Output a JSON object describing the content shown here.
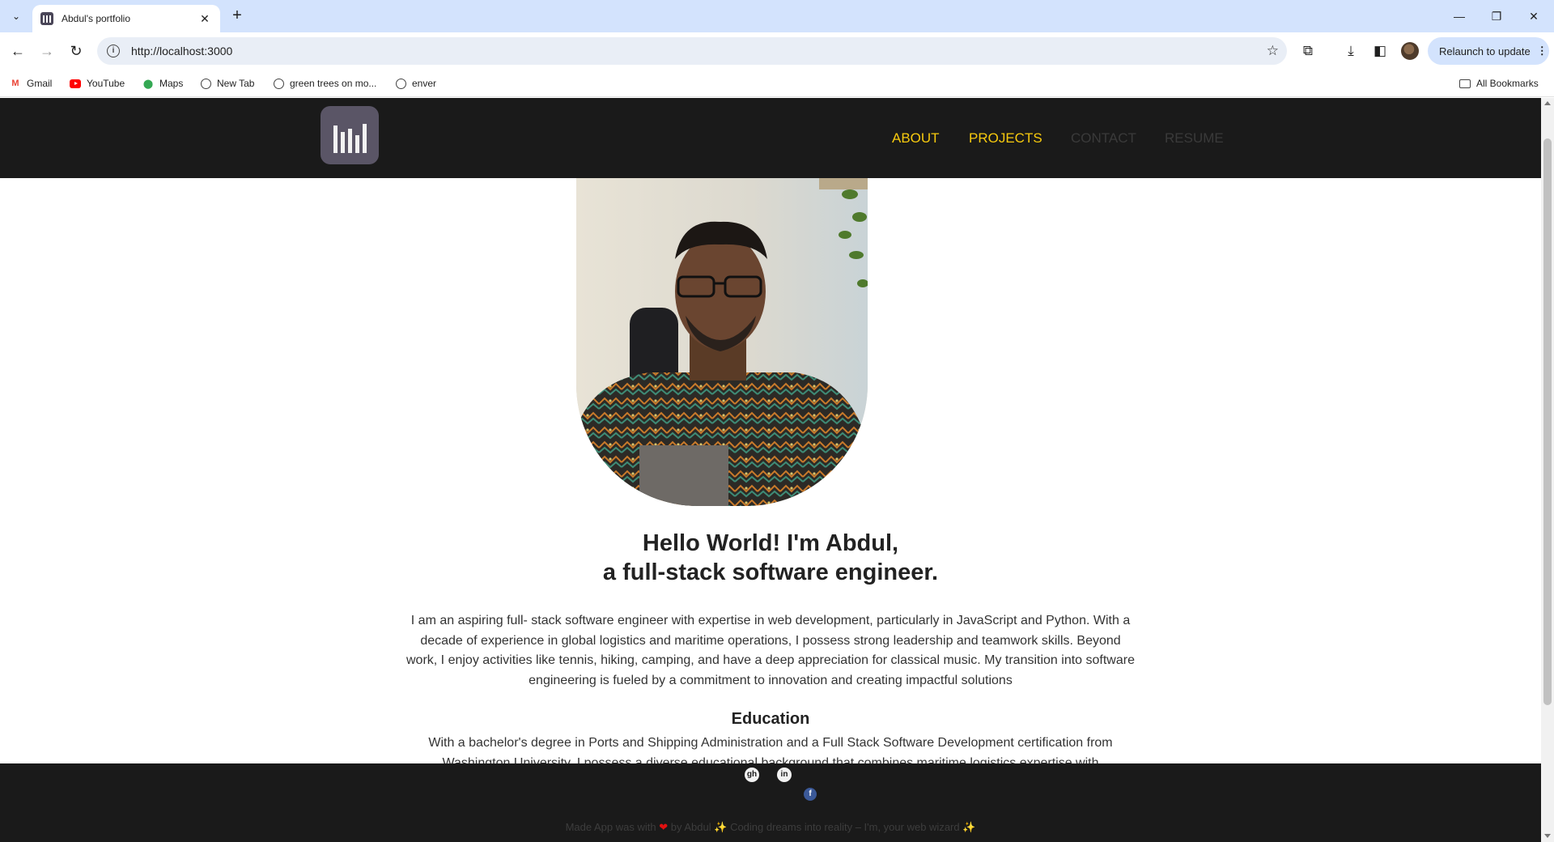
{
  "browser": {
    "tab_title": "Abdul's portfolio",
    "tab_close": "✕",
    "new_tab": "+",
    "url": "http://localhost:3000",
    "relaunch_label": "Relaunch to update",
    "bookmarks": [
      "Gmail",
      "YouTube",
      "Maps",
      "New Tab",
      "green trees on mo...",
      "enver"
    ],
    "all_bookmarks": "All Bookmarks"
  },
  "site": {
    "nav": [
      "ABOUT",
      "PROJECTS",
      "CONTACT",
      "RESUME"
    ],
    "hero_title_line1": "Hello World! I'm Abdul,",
    "hero_title_line2": "a full-stack software engineer.",
    "hero_text": "I am an aspiring full- stack software engineer with expertise in web development, particularly in JavaScript and Python. With a decade of experience in global logistics and maritime operations, I possess strong leadership and teamwork skills. Beyond work, I enjoy activities like tennis, hiking, camping, and have a deep appreciation for classical music. My transition into software engineering is fueled by a commitment to innovation and creating impactful solutions",
    "education_title": "Education",
    "education_text": "With a bachelor's degree in Ports and Shipping Administration and a Full Stack Software Development certification from Washington University, I possess a diverse educational background that combines maritime logistics expertise with",
    "footer": {
      "made_with": "Made App was with",
      "by": "by Abdul",
      "tagline": "Coding dreams into reality – I'm, your web wizard",
      "heart": "❤",
      "sparkle": "✨"
    }
  },
  "colors": {
    "header_bg": "#1a1a1a",
    "nav_active": "#f6c90e",
    "nav_inactive": "#3a3a3a",
    "browser_accent": "#d3e3fd"
  }
}
